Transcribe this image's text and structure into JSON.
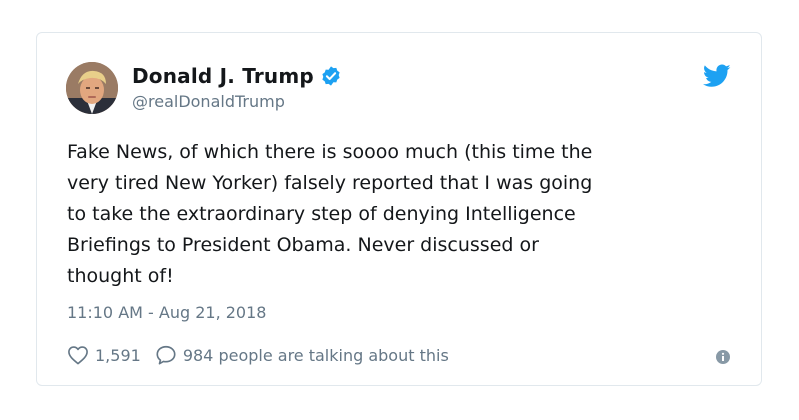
{
  "tweet": {
    "display_name": "Donald J. Trump",
    "handle": "@realDonaldTrump",
    "text": "Fake News, of which there is soooo much (this time the\nvery tired New Yorker) falsely reported that I was going\nto take the extraordinary step of denying Intelligence\nBriefings to President Obama. Never discussed or\nthought of!",
    "timestamp": "11:10 AM - Aug 21, 2018",
    "like_count": "1,591",
    "reply_text": "984 people are talking about this"
  },
  "colors": {
    "brand": "#1da1f2",
    "text_primary": "#14171a",
    "text_secondary": "#657786",
    "border": "#e1e8ed"
  },
  "icons": {
    "verified": "verified-badge-icon",
    "brand": "twitter-bird-icon",
    "like": "heart-icon",
    "reply": "speech-bubble-icon",
    "info": "info-icon"
  }
}
